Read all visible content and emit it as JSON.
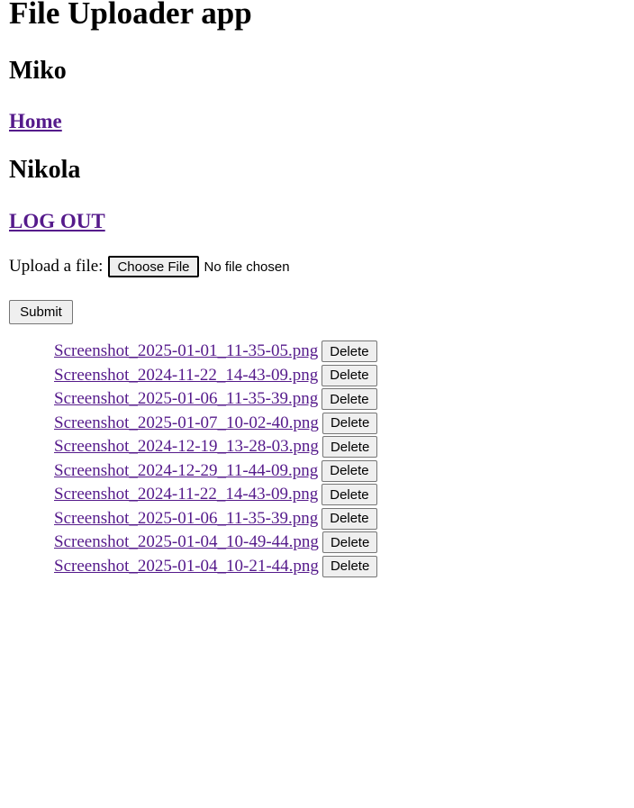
{
  "app": {
    "title": "File Uploader app"
  },
  "users": {
    "first": "Miko",
    "second": "Nikola"
  },
  "nav": {
    "home": "Home",
    "logout": "LOG OUT"
  },
  "upload": {
    "label": "Upload a file:",
    "choose_label": "Choose File",
    "status": "No file chosen",
    "submit_label": "Submit"
  },
  "files": [
    {
      "name": "Screenshot_2025-01-01_11-35-05.png ",
      "delete_label": "Delete"
    },
    {
      "name": "Screenshot_2024-11-22_14-43-09.png ",
      "delete_label": "Delete"
    },
    {
      "name": "Screenshot_2025-01-06_11-35-39.png ",
      "delete_label": "Delete"
    },
    {
      "name": "Screenshot_2025-01-07_10-02-40.png ",
      "delete_label": "Delete"
    },
    {
      "name": "Screenshot_2024-12-19_13-28-03.png ",
      "delete_label": "Delete"
    },
    {
      "name": "Screenshot_2024-12-29_11-44-09.png ",
      "delete_label": "Delete"
    },
    {
      "name": "Screenshot_2024-11-22_14-43-09.png ",
      "delete_label": "Delete"
    },
    {
      "name": "Screenshot_2025-01-06_11-35-39.png ",
      "delete_label": "Delete"
    },
    {
      "name": "Screenshot_2025-01-04_10-49-44.png ",
      "delete_label": "Delete"
    },
    {
      "name": "Screenshot_2025-01-04_10-21-44.png ",
      "delete_label": "Delete"
    }
  ],
  "colors": {
    "link_visited": "#551a8b",
    "button_bg": "#efefef"
  }
}
